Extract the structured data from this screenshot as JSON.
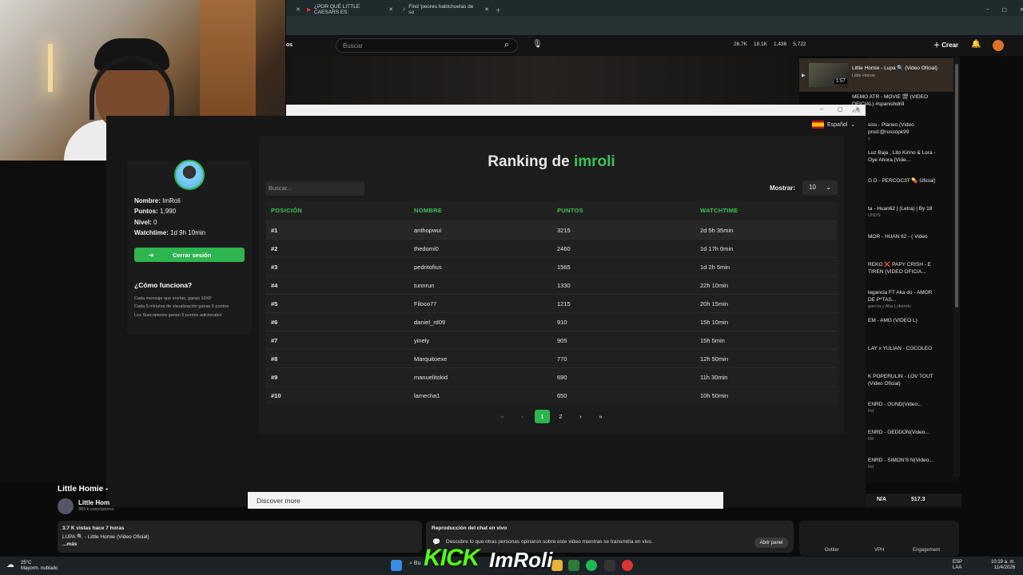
{
  "browser": {
    "tabs": [
      {
        "label": "¿POR QUÉ LITTLE CAESARS ES"
      },
      {
        "label": "Find 'peores habichuelas de so"
      }
    ]
  },
  "youtube": {
    "search_placeholder": "Buscar",
    "stats": [
      "26.7K",
      "18.1K",
      "1,436",
      "5,722"
    ],
    "create_label": "Crear",
    "logo_fragment": "os"
  },
  "site": {
    "language": "Español",
    "profile": {
      "name_label": "Nombre:",
      "name": "ImRoli",
      "points_label": "Puntos:",
      "points": "1,990",
      "level_label": "Nivel:",
      "level": "0",
      "watch_label": "Watchtime:",
      "watch": "1d 9h 10min",
      "logout": "Cerrar sesión"
    },
    "how": {
      "title": "¿Cómo funciona?",
      "lines": [
        "Cada mensaje que envías, ganas 10XP",
        "Cada 5 minutos de visualización ganas 5 puntos",
        "Los Suscriptores ganan 5 puntos adicionales"
      ]
    },
    "ranking": {
      "title_prefix": "Ranking de",
      "title_user": "imroli",
      "search_placeholder": "Buscar...",
      "show_label": "Mostrar:",
      "show_value": "10",
      "headers": [
        "POSICIÓN",
        "NOMBRE",
        "PUNTOS",
        "WATCHTIME"
      ],
      "rows": [
        {
          "pos": "#1",
          "name": "anthopwui",
          "points": "3215",
          "watch": "2d 5h 35min"
        },
        {
          "pos": "#2",
          "name": "thedomi0",
          "points": "2460",
          "watch": "1d 17h 0min"
        },
        {
          "pos": "#3",
          "name": "pedritofius",
          "points": "1565",
          "watch": "1d 2h 5min"
        },
        {
          "pos": "#4",
          "name": "tunnrun",
          "points": "1330",
          "watch": "22h 10min"
        },
        {
          "pos": "#5",
          "name": "Filoco77",
          "points": "1215",
          "watch": "20h 15min"
        },
        {
          "pos": "#6",
          "name": "daniel_rd09",
          "points": "910",
          "watch": "15h 10min"
        },
        {
          "pos": "#7",
          "name": "yinely",
          "points": "905",
          "watch": "15h 5min"
        },
        {
          "pos": "#8",
          "name": "Marquitoexe",
          "points": "770",
          "watch": "12h 50min"
        },
        {
          "pos": "#9",
          "name": "manuelitokid",
          "points": "690",
          "watch": "11h 30min"
        },
        {
          "pos": "#10",
          "name": "lamecha1",
          "points": "650",
          "watch": "10h 50min"
        }
      ],
      "pages": [
        "«",
        "‹",
        "1",
        "2",
        "›",
        "»"
      ]
    }
  },
  "sidebar": {
    "now_playing": {
      "title": "Little Homie - Lupa 🔍 (Video Oficial)",
      "channel": "Little Homie",
      "duration": "1:57"
    },
    "memo": "MEMO ATR - MOVIE 🎬 (VIDEO OFICIAL) #spanishdrill",
    "memo_channel": "ATR",
    "items": [
      {
        "title": "siss - Planeo (Video prod:@russopk99",
        "meta": "s"
      },
      {
        "title": "Luz Baja , Lito Kirino & Lora - Oye Ahora (Vide...",
        "meta": ""
      },
      {
        "title": "G D - PERCOC3T 💊 Oficial)",
        "meta": ""
      },
      {
        "title": "ta - Huan62 | (Letra) | By 18",
        "meta": "UNDS"
      },
      {
        "title": "MOR - HUAN 62 - ( Video",
        "meta": ""
      },
      {
        "title": "REKO ❌ PAPY CRISH - E TIREN (VIDEO OFICIA...",
        "meta": ""
      },
      {
        "title": "legancia FT Aka do - AMOR DE P*TAS...",
        "meta": "gancia y Aka Lokendo"
      },
      {
        "title": "EM - AMG (VIDEO L)",
        "meta": ""
      },
      {
        "title": "LAY x YULIAN - COCOLEO",
        "meta": ""
      },
      {
        "title": "K POPERULIN - LOV TOUT (Video Oficial)",
        "meta": ""
      },
      {
        "title": "ENRD - OUND(Video...",
        "meta": "Rd"
      },
      {
        "title": "ENRD - GEDDON(Video...",
        "meta": "Rd"
      },
      {
        "title": "ENRD - SIMON'S N(Video...",
        "meta": "Rd"
      }
    ]
  },
  "video": {
    "title": "Little Homie -",
    "channel": "Little Hom",
    "subs": "383 k suscriptores",
    "views": "3.7 K vistas  hace 7 horas",
    "desc": "LUPA 🔍 - Little Homie (Video Oficial)",
    "more": "...más"
  },
  "discover": "Discover more",
  "chat": {
    "title": "Reproducción del chat en vivo",
    "text": "Descubre lo que otras personas opinaron sobre este video mientras se transmitía en vivo.",
    "button": "Abrir panel"
  },
  "stats": {
    "na": "N/A",
    "value": "517.3",
    "labels": [
      "Outlier",
      "VPH",
      "Engagement"
    ]
  },
  "overlay": {
    "kick": "KICK",
    "name": "ImRoli"
  },
  "taskbar": {
    "temp": "25°C",
    "weather": "Mayorm. nublado",
    "search": "Bu",
    "lang1": "ESP",
    "lang2": "LAA",
    "time": "10:19 a. m.",
    "date": "11/4/2026"
  }
}
